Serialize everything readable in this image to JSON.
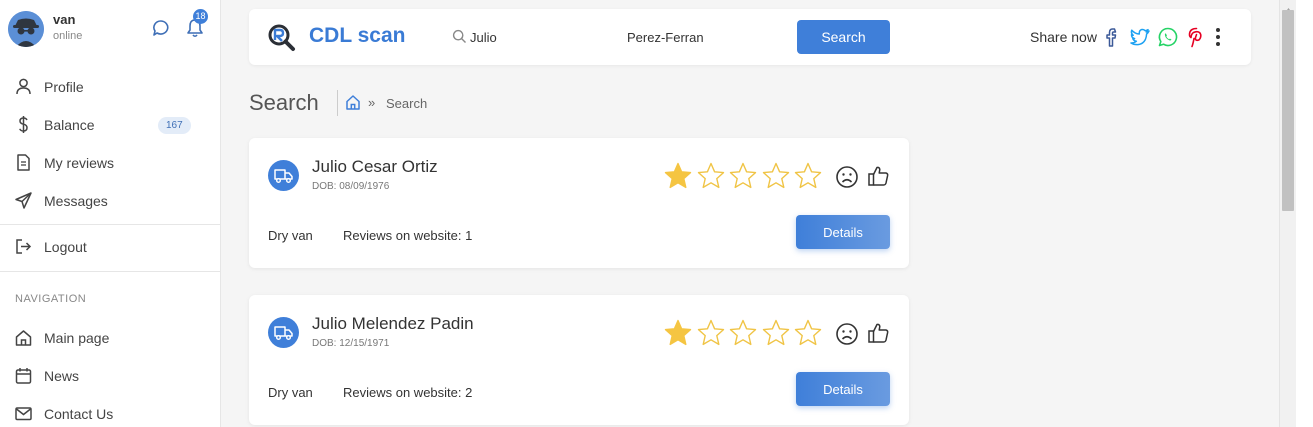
{
  "user": {
    "name": "van",
    "status": "online",
    "notification_count": "18"
  },
  "sidebar": {
    "items": [
      {
        "label": "Profile",
        "icon": "user-icon"
      },
      {
        "label": "Balance",
        "icon": "dollar-icon",
        "badge": "167"
      },
      {
        "label": "My reviews",
        "icon": "document-icon"
      },
      {
        "label": "Messages",
        "icon": "send-icon"
      },
      {
        "label": "Logout",
        "icon": "logout-icon"
      }
    ],
    "nav_heading": "NAVIGATION",
    "nav_items": [
      {
        "label": "Main page",
        "icon": "home-icon"
      },
      {
        "label": "News",
        "icon": "calendar-icon"
      },
      {
        "label": "Contact Us",
        "icon": "mail-icon"
      }
    ]
  },
  "header": {
    "logo_text": "CDL scan",
    "search_first_name": "Julio",
    "search_last_name": "Perez-Ferran",
    "search_button": "Search",
    "share_label": "Share now",
    "share_icons": [
      "facebook-icon",
      "twitter-icon",
      "whatsapp-icon",
      "pinterest-icon"
    ]
  },
  "page": {
    "title": "Search",
    "breadcrumb_separator": "»",
    "breadcrumb_current": "Search"
  },
  "results": [
    {
      "name": "Julio Cesar Ortiz",
      "dob": "DOB: 08/09/1976",
      "rating": 1,
      "rating_max": 5,
      "equipment": "Dry van",
      "reviews": "Reviews on website: 1",
      "details_label": "Details"
    },
    {
      "name": "Julio Melendez Padin",
      "dob": "DOB: 12/15/1971",
      "rating": 1,
      "rating_max": 5,
      "equipment": "Dry van",
      "reviews": "Reviews on website: 2",
      "details_label": "Details"
    }
  ],
  "colors": {
    "accent": "#3f7fd9",
    "star_filled": "#f5c542",
    "star_outline": "#f0c445",
    "facebook": "#3b5998",
    "twitter": "#1da1f2",
    "whatsapp": "#25d366",
    "pinterest": "#e60023"
  }
}
